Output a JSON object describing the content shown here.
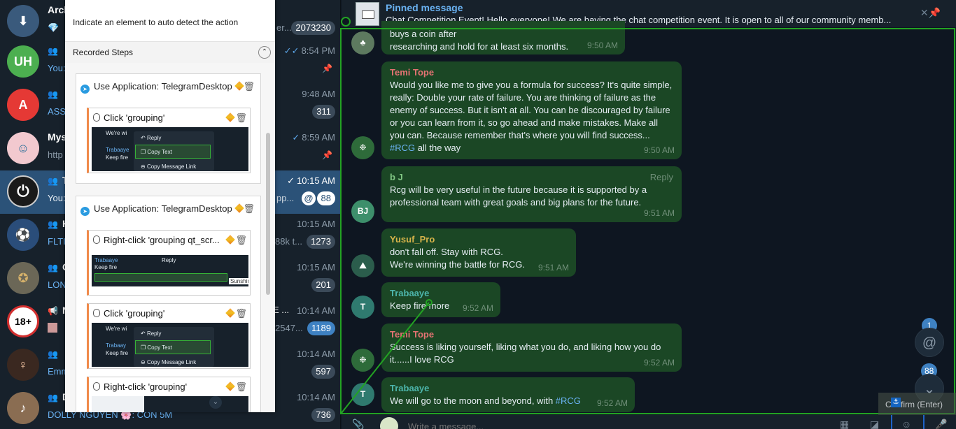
{
  "chat_list": [
    {
      "name": "Arch",
      "name_suffix": "",
      "is_group": false,
      "preview": "💎",
      "extra_text": "er...",
      "time": "",
      "badge": "2073230",
      "badge_blue": false,
      "pinned": false,
      "avatar_bg": "#3a5a7c",
      "avatar_icon": "archive-icon"
    },
    {
      "name": "",
      "name_suffix": "",
      "is_group": true,
      "preview": "You:",
      "extra_text": "",
      "time": "8:54 PM",
      "time_tick": "✓✓",
      "badge": "",
      "pinned": true,
      "avatar_bg": "#4caf50",
      "avatar_text": "UH"
    },
    {
      "name": "",
      "is_group": true,
      "preview": "ASSA",
      "extra_text": "",
      "time": "9:48 AM",
      "badge": "311",
      "badge_blue": false,
      "pinned": false,
      "avatar_bg": "#e53935",
      "avatar_text": "A"
    },
    {
      "name": "Mys",
      "is_group": false,
      "preview": "http",
      "extra_text": "",
      "time": "8:59 AM",
      "time_tick": "✓",
      "badge": "",
      "pinned": true,
      "avatar_bg": "#f2c9cf"
    },
    {
      "name": "T",
      "is_group": true,
      "preview": "You:",
      "extra_text": "pp...",
      "time": "10:15 AM",
      "time_tick": "✓",
      "badge": "88",
      "mention": "@",
      "badge_blue": false,
      "active": true,
      "avatar_bg": "#1a1a1a"
    },
    {
      "name": "K",
      "is_group": true,
      "preview": "FLTI",
      "extra_text": "88k t...",
      "time": "10:15 AM",
      "badge": "1273",
      "badge_blue": false,
      "avatar_bg": "#2a4d7a"
    },
    {
      "name": "C",
      "is_group": true,
      "preview": "LON",
      "extra_text": "",
      "time": "10:15 AM",
      "badge": "201",
      "badge_blue": false,
      "avatar_bg": "#6b6757"
    },
    {
      "name": "N",
      "is_group": true,
      "preview": "",
      "extra_text": "2547...",
      "name_extra": "E ...",
      "time": "10:14 AM",
      "badge": "1189",
      "badge_blue": true,
      "avatar_bg": "#ffffff",
      "avatar_text": "18+"
    },
    {
      "name": "",
      "is_group": true,
      "preview": "Emm",
      "extra_text": "",
      "time": "10:14 AM",
      "badge": "597",
      "badge_blue": false,
      "avatar_bg": "#3a2820"
    },
    {
      "name": "D",
      "is_group": true,
      "preview": "DOLLY NGUYEN 🌸: CON 5M",
      "extra_text": "",
      "time": "10:14 AM",
      "badge": "736",
      "badge_blue": false,
      "avatar_bg": "#8a6d52"
    }
  ],
  "recorder": {
    "hint": "Indicate an element to auto detect the action",
    "header": "Recorded Steps",
    "collapse_icon": "⌃",
    "steps": [
      {
        "app_label": "Use Application: TelegramDesktop",
        "substeps": [
          {
            "title": "Click 'grouping'",
            "thumb_menu": [
              "Reply",
              "Copy Text",
              "Copy Message Link"
            ],
            "thumb_text": [
              "We're wi",
              "Trabaaye",
              "Keep fire"
            ]
          }
        ]
      },
      {
        "app_label": "Use Application: TelegramDesktop",
        "substeps": [
          {
            "title": "Right-click 'grouping qt_scr...",
            "thumb_text": [
              "Trabaaye",
              "Keep fire",
              "Reply",
              "Sunshine Beds"
            ]
          },
          {
            "title": "Click 'grouping'",
            "thumb_menu": [
              "Reply",
              "Copy Text",
              "Copy Message Link"
            ],
            "thumb_text": [
              "We're wi",
              "Trabaay",
              "Keep fire"
            ]
          },
          {
            "title": "Right-click 'grouping'"
          }
        ]
      }
    ]
  },
  "pinned": {
    "title": "Pinned message",
    "text": "Chat Competition Event!  Hello everyone!  We are having the chat competition event. It is open to all of our community memb...",
    "unpin_icon": "⚲"
  },
  "messages": [
    {
      "sender": "",
      "text": "buys a coin after\n researching and hold for at least six months.",
      "time": "9:50 AM"
    },
    {
      "sender": "Temi Tope",
      "sender_color": "#e57373",
      "text": "Would you like me to give you a formula for success? It's quite simple, really: Double your rate of failure. You are thinking of failure as the enemy of success. But it isn't at all. You can be discouraged by failure or you can learn from it, so go ahead and make mistakes. Make all you can. Because remember that's where you will find success...",
      "tag": "#RCG",
      "text_after": " all the way",
      "time": "9:50 AM"
    },
    {
      "sender": "b J",
      "sender_color": "#81c784",
      "text": "Rcg will be very useful in the future because it is supported by a professional team with great goals and big plans for the future.",
      "time": "9:51 AM",
      "reply_label": "Reply",
      "avatar_text": "BJ"
    },
    {
      "sender": "Yusuf_Pro",
      "sender_color": "#d7b44a",
      "text": "don't fall off. Stay with RCG.\nWe're winning the battle for RCG.",
      "time": "9:51 AM"
    },
    {
      "sender": "Trabaaye",
      "sender_color": "#4db6ac",
      "text": "Keep fire more",
      "time": "9:52 AM",
      "avatar_text": "T"
    },
    {
      "sender": "Temi Tope",
      "sender_color": "#e57373",
      "text": "Success is liking yourself, liking what you do, and liking how you do it......I love RCG",
      "time": "9:52 AM"
    },
    {
      "sender": "Trabaaye",
      "sender_color": "#4db6ac",
      "text": "We will go to the moon and beyond, with ",
      "tag": "#RCG",
      "time": "9:52 AM",
      "avatar_text": "T"
    }
  ],
  "fab": {
    "mentions_count": "1",
    "mention_icon": "@",
    "unread_count": "88",
    "down_icon": "⌄"
  },
  "tooltip": "Confirm (Enter)",
  "composer": {
    "placeholder": "Write a message..."
  },
  "colors": {
    "sidebar_bg": "#17212b",
    "chat_bg": "#0e1621",
    "accent": "#6ab2f2",
    "selection": "#23a323"
  }
}
